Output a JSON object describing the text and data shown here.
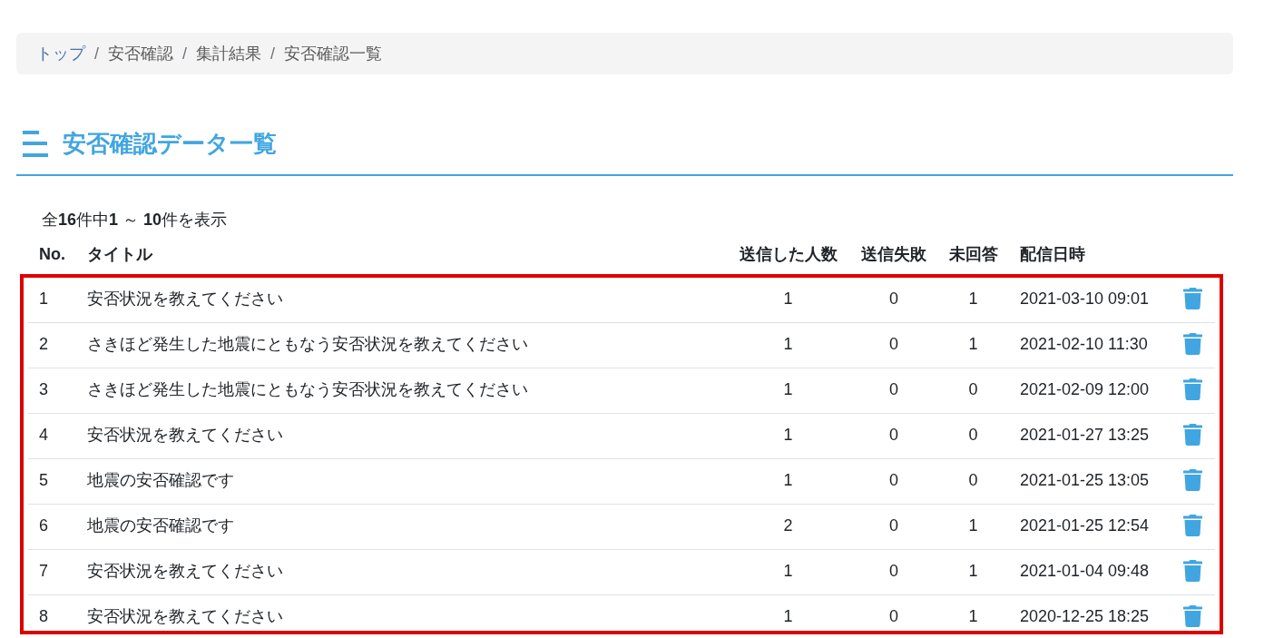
{
  "breadcrumb": [
    {
      "label": "トップ",
      "link": true
    },
    {
      "separator": "/",
      "label": "安否確認",
      "link": false
    },
    {
      "separator": "/",
      "label": "集計結果",
      "link": false
    },
    {
      "separator": "/",
      "label": "安否確認一覧",
      "link": false
    }
  ],
  "heading": {
    "title": "安否確認データ一覧"
  },
  "summary": "全**16**件中**1** ～ **10**件を表示",
  "table": {
    "columns": [
      "No.",
      "タイトル",
      "送信した人数",
      "送信失敗",
      "未回答",
      "配信日時"
    ],
    "rows": [
      {
        "no": "1",
        "title": "安否状況を教えてください",
        "sent": "1",
        "failed": "0",
        "unanswered": "1",
        "delivered_at": "2021-03-10 09:01"
      },
      {
        "no": "2",
        "title": "さきほど発生した地震にともなう安否状況を教えてください",
        "sent": "1",
        "failed": "0",
        "unanswered": "1",
        "delivered_at": "2021-02-10 11:30"
      },
      {
        "no": "3",
        "title": "さきほど発生した地震にともなう安否状況を教えてください",
        "sent": "1",
        "failed": "0",
        "unanswered": "0",
        "delivered_at": "2021-02-09 12:00"
      },
      {
        "no": "4",
        "title": "安否状況を教えてください",
        "sent": "1",
        "failed": "0",
        "unanswered": "0",
        "delivered_at": "2021-01-27 13:25"
      },
      {
        "no": "5",
        "title": "地震の安否確認です",
        "sent": "1",
        "failed": "0",
        "unanswered": "0",
        "delivered_at": "2021-01-25 13:05"
      },
      {
        "no": "6",
        "title": "地震の安否確認です",
        "sent": "2",
        "failed": "0",
        "unanswered": "1",
        "delivered_at": "2021-01-25 12:54"
      },
      {
        "no": "7",
        "title": "安否状況を教えてください",
        "sent": "1",
        "failed": "0",
        "unanswered": "1",
        "delivered_at": "2021-01-04 09:48"
      },
      {
        "no": "8",
        "title": "安否状況を教えてください",
        "sent": "1",
        "failed": "0",
        "unanswered": "1",
        "delivered_at": "2020-12-25 18:25"
      }
    ]
  }
}
